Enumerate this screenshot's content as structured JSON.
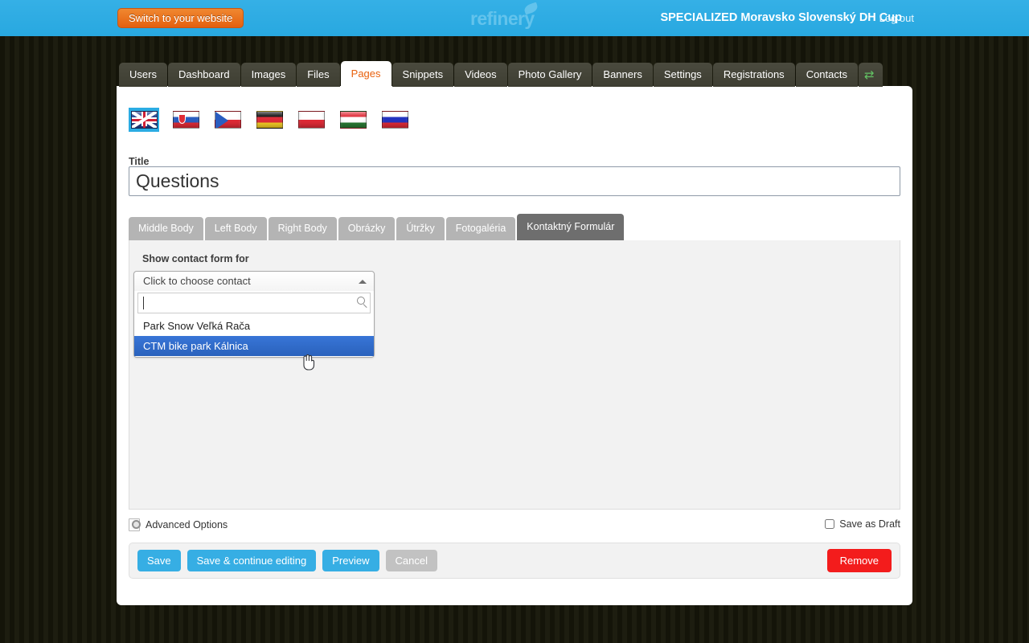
{
  "topbar": {
    "switch_label": "Switch to your website",
    "logo_text": "refinery",
    "site_title": "SPECIALIZED Moravsko Slovenský DH Cup",
    "logout_label": "Log out",
    "bg_color": "#2eace3",
    "accent_orange": "#e4600f"
  },
  "main_tabs": [
    {
      "label": "Users",
      "active": false
    },
    {
      "label": "Dashboard",
      "active": false
    },
    {
      "label": "Images",
      "active": false
    },
    {
      "label": "Files",
      "active": false
    },
    {
      "label": "Pages",
      "active": true
    },
    {
      "label": "Snippets",
      "active": false
    },
    {
      "label": "Videos",
      "active": false
    },
    {
      "label": "Photo Gallery",
      "active": false
    },
    {
      "label": "Banners",
      "active": false
    },
    {
      "label": "Settings",
      "active": false
    },
    {
      "label": "Registrations",
      "active": false
    },
    {
      "label": "Contacts",
      "active": false
    }
  ],
  "main_tabs_icon": "shuffle-icon",
  "locales": [
    {
      "code": "en",
      "name": "English",
      "selected": true
    },
    {
      "code": "sk",
      "name": "Slovak",
      "selected": false
    },
    {
      "code": "cs",
      "name": "Czech",
      "selected": false
    },
    {
      "code": "de",
      "name": "German",
      "selected": false
    },
    {
      "code": "pl",
      "name": "Polish",
      "selected": false
    },
    {
      "code": "hu",
      "name": "Hungarian",
      "selected": false
    },
    {
      "code": "ru",
      "name": "Russian",
      "selected": false
    }
  ],
  "form": {
    "title_label": "Title",
    "title_value": "Questions",
    "title_placeholder": ""
  },
  "body_tabs": [
    {
      "label": "Middle Body",
      "active": false
    },
    {
      "label": "Left Body",
      "active": false
    },
    {
      "label": "Right Body",
      "active": false
    },
    {
      "label": "Obrázky",
      "active": false
    },
    {
      "label": "Útržky",
      "active": false
    },
    {
      "label": "Fotogaléria",
      "active": false
    },
    {
      "label": "Kontaktný Formulár",
      "active": true
    }
  ],
  "contact_form": {
    "label": "Show contact form for",
    "dropdown_placeholder": "Click to choose contact",
    "search_value": "",
    "search_placeholder": "",
    "options": [
      {
        "label": "Park Snow Veľká Rača",
        "highlighted": false
      },
      {
        "label": "CTM bike park Kálnica",
        "highlighted": true
      }
    ]
  },
  "footer": {
    "advanced_options": "Advanced Options",
    "save_as_draft": "Save as Draft",
    "save_as_draft_checked": false
  },
  "actions": {
    "save": "Save",
    "save_continue": "Save & continue editing",
    "preview": "Preview",
    "cancel": "Cancel",
    "remove": "Remove",
    "remove_color": "#f31c1c",
    "primary_color": "#36aee4"
  }
}
